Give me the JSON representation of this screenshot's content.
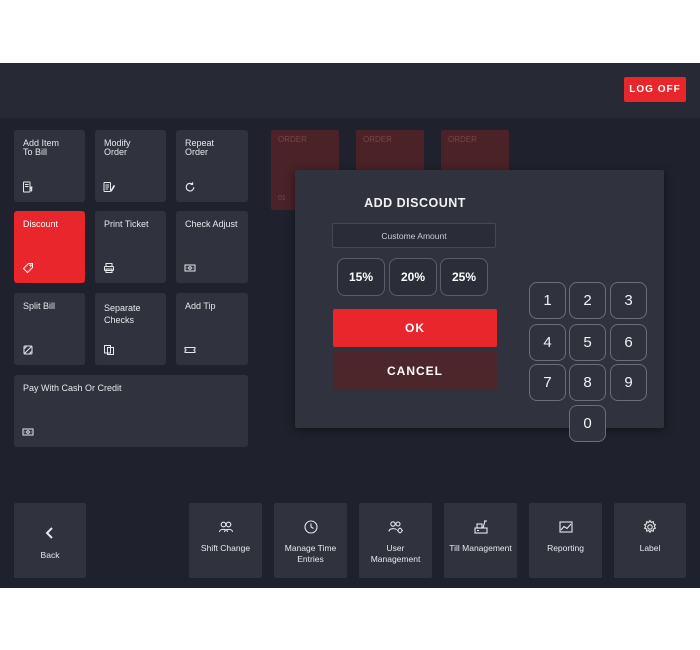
{
  "header": {
    "logoff_label": "LOG OFF"
  },
  "actions": {
    "add_item": "Add Item To Bill",
    "modify_order": "Modify Order",
    "repeat_order": "Repeat Order",
    "discount": "Discount",
    "print_ticket": "Print Ticket",
    "check_adjust": "Check Adjust",
    "split_bill": "Split Bill",
    "separate_checks": "Separate Checks",
    "add_tip": "Add Tip",
    "pay": "Pay With Cash Or Credit"
  },
  "orders": [
    {
      "label": "ORDER",
      "number": "01"
    },
    {
      "label": "ORDER",
      "number": ""
    },
    {
      "label": "ORDER",
      "number": ""
    }
  ],
  "discount_dialog": {
    "title": "ADD DISCOUNT",
    "custom_placeholder": "Custome Amount",
    "presets": [
      "15%",
      "20%",
      "25%"
    ],
    "ok_label": "OK",
    "cancel_label": "CANCEL",
    "keypad": [
      "1",
      "2",
      "3",
      "4",
      "5",
      "6",
      "7",
      "8",
      "9",
      "0"
    ]
  },
  "nav": {
    "back": "Back",
    "shift_change": "Shift Change",
    "manage_time": "Manage Time Entries",
    "user_management": "User Management",
    "till_management": "Till Management",
    "reporting": "Reporting",
    "label": "Label"
  },
  "colors": {
    "accent": "#e8262b",
    "background": "#1f222c",
    "panel": "#30333d",
    "cancel": "#4c262b"
  }
}
